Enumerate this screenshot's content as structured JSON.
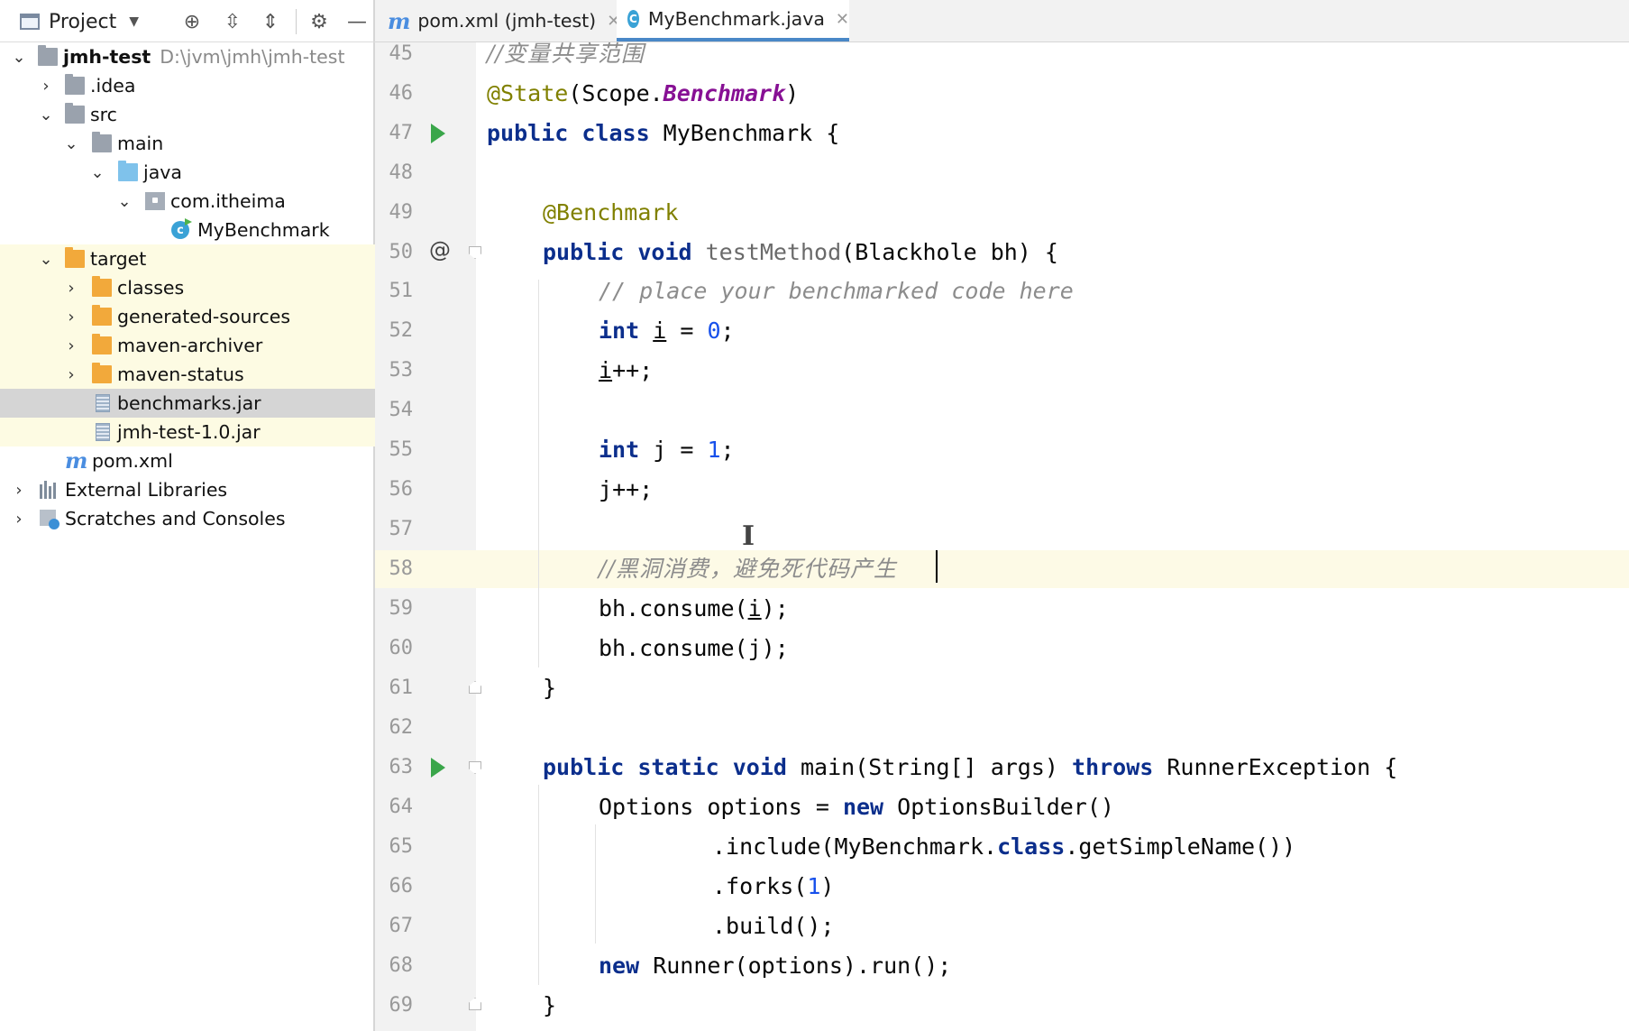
{
  "project_toolbar": {
    "title": "Project"
  },
  "tree": [
    {
      "label": "jmh-test",
      "path": "D:\\jvm\\jmh\\jmh-test"
    },
    {
      "label": ".idea"
    },
    {
      "label": "src"
    },
    {
      "label": "main"
    },
    {
      "label": "java"
    },
    {
      "label": "com.itheima"
    },
    {
      "label": "MyBenchmark"
    },
    {
      "label": "target"
    },
    {
      "label": "classes"
    },
    {
      "label": "generated-sources"
    },
    {
      "label": "maven-archiver"
    },
    {
      "label": "maven-status"
    },
    {
      "label": "benchmarks.jar"
    },
    {
      "label": "jmh-test-1.0.jar"
    },
    {
      "label": "pom.xml"
    },
    {
      "label": "External Libraries"
    },
    {
      "label": "Scratches and Consoles"
    }
  ],
  "tabs": [
    {
      "label": "pom.xml (jmh-test)",
      "icon": "m"
    },
    {
      "label": "MyBenchmark.java",
      "icon": "C"
    }
  ],
  "line_numbers": [
    "45",
    "46",
    "47",
    "48",
    "49",
    "50",
    "51",
    "52",
    "53",
    "54",
    "55",
    "56",
    "57",
    "58",
    "59",
    "60",
    "61",
    "62",
    "63",
    "64",
    "65",
    "66",
    "67",
    "68",
    "69"
  ],
  "code": {
    "l45": "//变量共享范围",
    "l46_ann": "@State",
    "l46_a": "(Scope.",
    "l46_enum": "Benchmark",
    "l46_b": ")",
    "l47_kw": "public class ",
    "l47_name": "MyBenchmark",
    "l47_rest": " {",
    "l49": "@Benchmark",
    "l50_kw": "public void ",
    "l50_m": "testMethod",
    "l50_rest": "(Blackhole bh) {",
    "l51": "// place your benchmarked code here",
    "l52_kw": "int ",
    "l52_var": "i",
    "l52_eq": " = ",
    "l52_num": "0",
    "l52_end": ";",
    "l53_var": "i",
    "l53_rest": "++;",
    "l55_kw": "int ",
    "l55_var": "j",
    "l55_eq": " = ",
    "l55_num": "1",
    "l55_end": ";",
    "l56_var": "j",
    "l56_rest": "++;",
    "l58": "//黑洞消费，避免死代码产生",
    "l59_a": "bh.consume(",
    "l59_var": "i",
    "l59_b": ");",
    "l60_a": "bh.consume(",
    "l60_var": "j",
    "l60_b": ");",
    "l61": "}",
    "l63_kw": "public static void ",
    "l63_a": "main(String[] args) ",
    "l63_kw2": "throws",
    "l63_b": " RunnerException {",
    "l64_a": "Options options = ",
    "l64_kw": "new",
    "l64_b": " OptionsBuilder()",
    "l65_a": ".include(MyBenchmark.",
    "l65_kw": "class",
    "l65_b": ".getSimpleName())",
    "l66_a": ".forks(",
    "l66_num": "1",
    "l66_b": ")",
    "l67": ".build();",
    "l68_kw": "new",
    "l68_a": " Runner(options).run();",
    "l69": "}"
  }
}
